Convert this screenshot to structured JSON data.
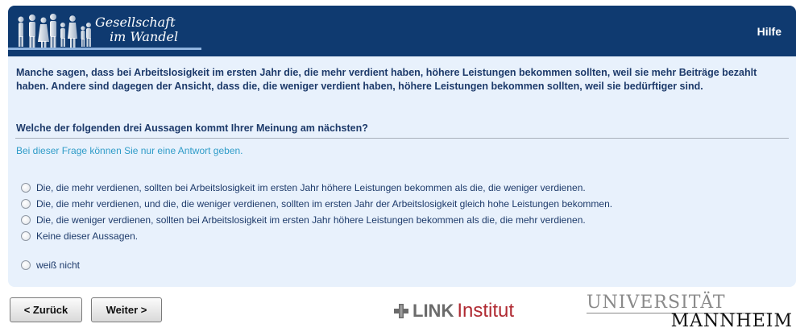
{
  "header": {
    "logo_line1": "Gesellschaft",
    "logo_line2": "im Wandel",
    "help_label": "Hilfe"
  },
  "survey": {
    "intro": "Manche sagen, dass bei Arbeitslosigkeit im ersten Jahr die, die mehr verdient haben, höhere Leistungen bekommen sollten, weil sie mehr Beiträge bezahlt haben. Andere sind dagegen der Ansicht, dass die, die weniger verdient haben, höhere Leistungen bekommen sollten, weil sie bedürftiger sind.",
    "question": "Welche der folgenden drei Aussagen kommt Ihrer Meinung am nächsten?",
    "hint": "Bei dieser Frage können Sie nur eine Antwort geben.",
    "options": [
      "Die, die mehr verdienen, sollten bei Arbeitslosigkeit im ersten Jahr höhere Leistungen bekommen als die, die weniger verdienen.",
      "Die, die mehr verdienen, und die, die weniger verdienen, sollten im ersten Jahr der Arbeitslosigkeit gleich hohe Leistungen bekommen.",
      "Die, die weniger verdienen, sollten bei Arbeitslosigkeit im ersten Jahr höhere Leistungen bekommen als die, die mehr verdienen.",
      "Keine dieser Aussagen."
    ],
    "dont_know": "weiß nicht"
  },
  "nav": {
    "back_label": "< Zurück",
    "next_label": "Weiter >"
  },
  "footer": {
    "link_word": "LINK",
    "link_inst": "Institut",
    "uni_line1": "UNIVERSITÄT",
    "uni_line2": "MANNHEIM"
  },
  "colors": {
    "header_bg": "#0f3a70",
    "panel_bg": "#e8f1fc",
    "text_dark_blue": "#1d3a6a",
    "hint_cyan": "#2f9cc8",
    "link_red": "#b02a32"
  }
}
